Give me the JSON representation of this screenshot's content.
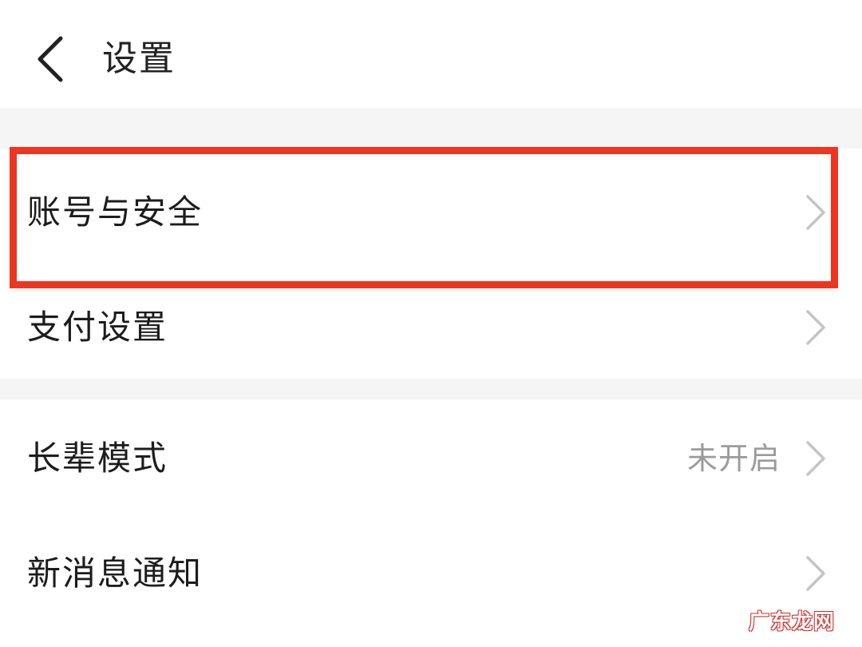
{
  "header": {
    "back_icon": "chevron-left-icon",
    "title": "设置"
  },
  "groups": [
    {
      "items": [
        {
          "label": "账号与安全",
          "value": "",
          "icon": "chevron-right-icon",
          "highlighted": true
        },
        {
          "label": "支付设置",
          "value": "",
          "icon": "chevron-right-icon"
        }
      ]
    },
    {
      "items": [
        {
          "label": "长辈模式",
          "value": "未开启",
          "icon": "chevron-right-icon"
        },
        {
          "label": "新消息通知",
          "value": "",
          "icon": "chevron-right-icon"
        }
      ]
    }
  ],
  "highlight": {
    "color": "#ee3520"
  },
  "watermark": {
    "text": "广东龙网"
  },
  "colors": {
    "background": "#f5f5f5",
    "surface": "#ffffff",
    "text": "#1c1c1c",
    "secondary_text": "#9b9b9b",
    "chevron": "#c4c4c4"
  }
}
